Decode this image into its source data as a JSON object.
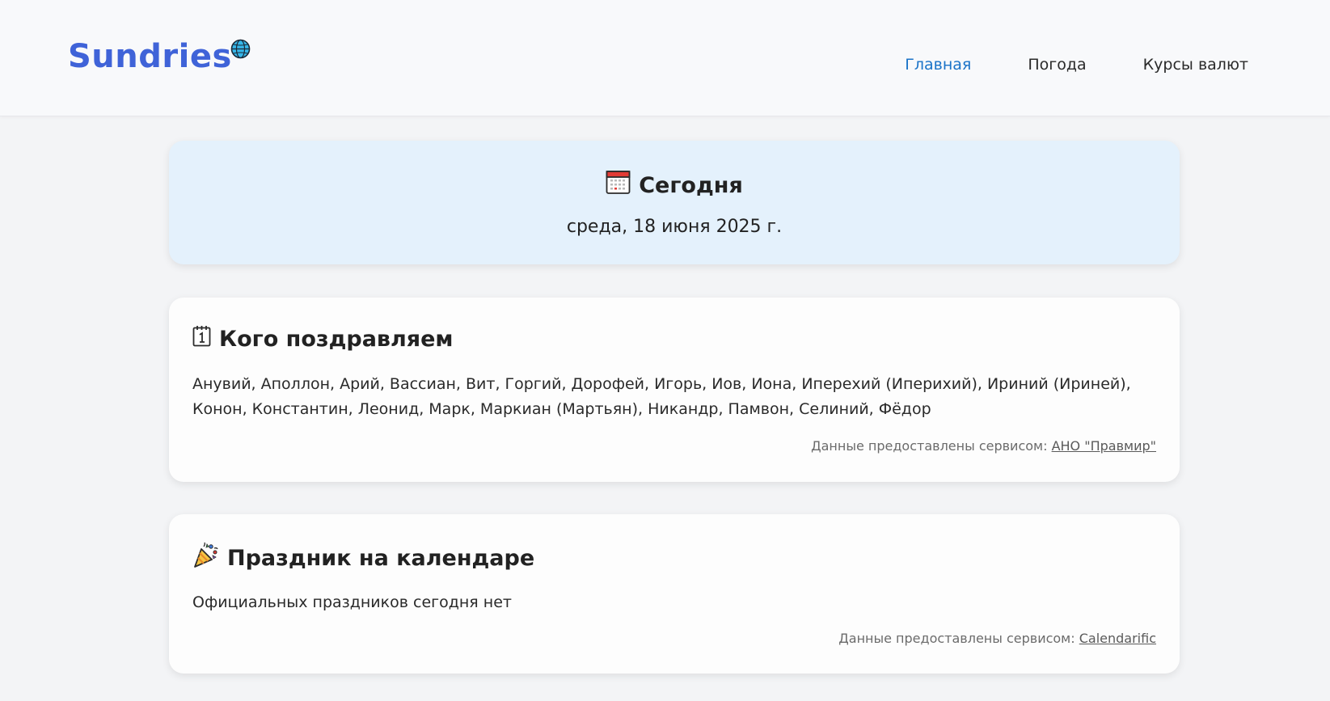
{
  "header": {
    "logo_text": "Sundries",
    "logo_icon": "globe-icon",
    "nav": [
      {
        "label": "Главная",
        "active": true
      },
      {
        "label": "Погода",
        "active": false
      },
      {
        "label": "Курсы валют",
        "active": false
      }
    ]
  },
  "today": {
    "icon": "calendar-icon",
    "title": "Сегодня",
    "date": "среда, 18 июня 2025 г."
  },
  "names_card": {
    "icon": "calendar-page-icon",
    "title": "Кого поздравляем",
    "body": "Анувий, Аполлон, Арий, Вассиан, Вит, Горгий, Дорофей, Игорь, Иов, Иона, Иперехий (Иперихий), Ириний (Ириней), Конон, Константин, Леонид, Марк, Маркиан (Мартьян), Никандр, Памвон, Селиний, Фёдор",
    "source_prefix": "Данные предоставлены сервисом:",
    "source_link": "АНО \"Правмир\""
  },
  "holiday_card": {
    "icon": "party-popper-icon",
    "title": "Праздник на календаре",
    "body": "Официальных праздников сегодня нет",
    "source_prefix": "Данные предоставлены сервисом:",
    "source_link": "Calendarific"
  },
  "colors": {
    "brand": "#3f63d8",
    "nav_active": "#1a73c8",
    "today_bg": "#e4f1fc",
    "page_bg": "#f3f4f6"
  }
}
